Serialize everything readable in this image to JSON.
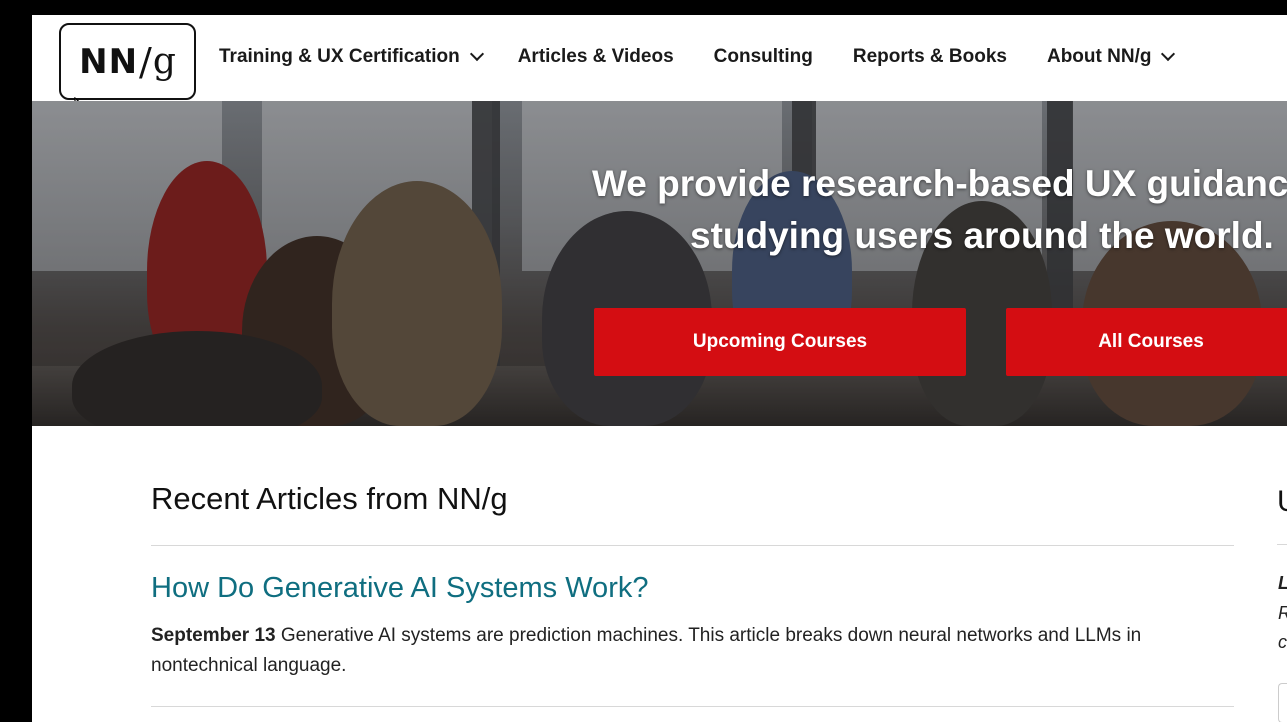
{
  "header": {
    "logo": {
      "nn": "NN",
      "slash": "/",
      "g": "g"
    },
    "nav": [
      {
        "label": "Training & UX Certification",
        "has_dropdown": true
      },
      {
        "label": "Articles & Videos",
        "has_dropdown": false
      },
      {
        "label": "Consulting",
        "has_dropdown": false
      },
      {
        "label": "Reports & Books",
        "has_dropdown": false
      },
      {
        "label": "About NN/g",
        "has_dropdown": true
      }
    ]
  },
  "hero": {
    "title_line1": "We provide research-based UX guidanc",
    "title_line2": "studying users around the world.",
    "buttons": {
      "upcoming": "Upcoming Courses",
      "all": "All Courses"
    }
  },
  "recent": {
    "heading": "Recent Articles from NN/g",
    "articles": [
      {
        "title": "How Do Generative AI Systems Work?",
        "date": "September 13",
        "summary": "Generative AI systems are prediction machines. This article breaks down neural networks and LLMs in nontechnical language."
      }
    ]
  },
  "sidebar_fragment": {
    "heading_char": "U",
    "frag1": "L",
    "frag2": "R",
    "frag3": "c"
  },
  "colors": {
    "brand_red": "#d40d12",
    "link_teal": "#0f6e80",
    "text": "#111111"
  },
  "icons": [
    "chevron-down-icon",
    "mouse-pointer-icon"
  ]
}
